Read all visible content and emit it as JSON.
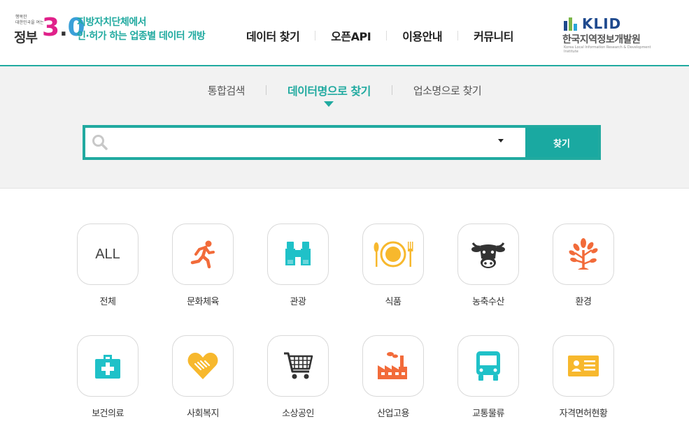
{
  "header": {
    "gov_logo": {
      "small_line1": "행복한",
      "small_line2": "대한민국을 여는",
      "word": "정부",
      "number": "3.0"
    },
    "tagline_line1": "지방자치단체에서",
    "tagline_line2": "인·허가 하는 업종별 데이터 개방",
    "nav": [
      "데이터 찾기",
      "오픈API",
      "이용안내",
      "커뮤니티"
    ],
    "klid": {
      "mark": "KLID",
      "korean": "한국지역정보개발원",
      "english": "Korea Local Information Research & Development Institute"
    }
  },
  "search": {
    "tabs": [
      {
        "label": "통합검색",
        "active": false
      },
      {
        "label": "데이터명으로 찾기",
        "active": true
      },
      {
        "label": "업소명으로 찾기",
        "active": false
      }
    ],
    "input_value": "",
    "placeholder": "",
    "button_label": "찾기"
  },
  "categories": [
    {
      "label": "전체",
      "icon": "all-text",
      "icon_text": "ALL"
    },
    {
      "label": "문화체육",
      "icon": "running-person-icon",
      "color": "#f26b3a"
    },
    {
      "label": "관광",
      "icon": "binoculars-icon",
      "color": "#1fc1c8"
    },
    {
      "label": "식품",
      "icon": "plate-cutlery-icon",
      "color": "#f7b82d"
    },
    {
      "label": "농축수산",
      "icon": "cow-icon",
      "color": "#333333"
    },
    {
      "label": "환경",
      "icon": "tree-icon",
      "color": "#f26b3a"
    },
    {
      "label": "보건의료",
      "icon": "first-aid-kit-icon",
      "color": "#1fc1c8"
    },
    {
      "label": "사회복지",
      "icon": "heart-handshake-icon",
      "color": "#f7b82d"
    },
    {
      "label": "소상공인",
      "icon": "shopping-cart-icon",
      "color": "#333333"
    },
    {
      "label": "산업고용",
      "icon": "factory-icon",
      "color": "#f26b3a"
    },
    {
      "label": "교통물류",
      "icon": "bus-icon",
      "color": "#1fc1c8"
    },
    {
      "label": "자격면허현황",
      "icon": "id-card-icon",
      "color": "#f7b82d"
    }
  ],
  "colors": {
    "accent": "#21aaa0",
    "orange": "#f26b3a",
    "teal": "#1fc1c8",
    "yellow": "#f7b82d",
    "dark": "#333333"
  }
}
